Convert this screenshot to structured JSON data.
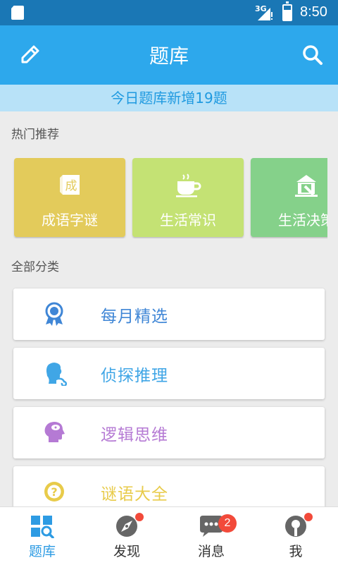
{
  "status_bar": {
    "network": "3G",
    "time": "8:50",
    "battery_level": 0.7
  },
  "header": {
    "title": "题库",
    "left_icon": "edit-icon",
    "right_icon": "search-icon"
  },
  "banner": {
    "text": "今日题库新增19题"
  },
  "hot": {
    "section_title": "热门推荐",
    "cards": [
      {
        "label": "成语字谜",
        "icon": "idiom-scroll-icon",
        "color": "#e3cb5b"
      },
      {
        "label": "生活常识",
        "icon": "coffee-cup-icon",
        "color": "#c4e274"
      },
      {
        "label": "生活决策",
        "icon": "gavel-icon",
        "color": "#85d18a"
      }
    ]
  },
  "categories": {
    "section_title": "全部分类",
    "items": [
      {
        "label": "每月精选",
        "icon": "medal-icon",
        "color": "#3f86d6"
      },
      {
        "label": "侦探推理",
        "icon": "detective-icon",
        "color": "#40a6e6"
      },
      {
        "label": "逻辑思维",
        "icon": "brain-head-icon",
        "color": "#b57ad4"
      },
      {
        "label": "谜语大全",
        "icon": "question-circle-icon",
        "color": "#e8cb4a"
      }
    ]
  },
  "bottom_nav": [
    {
      "label": "题库",
      "icon": "grid-search-icon",
      "active": true
    },
    {
      "label": "发现",
      "icon": "compass-icon",
      "dot": true
    },
    {
      "label": "消息",
      "icon": "chat-icon",
      "badge": "2"
    },
    {
      "label": "我",
      "icon": "profile-icon",
      "dot": true
    }
  ],
  "colors": {
    "status_bar": "#1a77b5",
    "header": "#2da8ec",
    "banner_bg": "#b8e2f8",
    "accent": "#2d9be3",
    "badge": "#f24a3a"
  }
}
